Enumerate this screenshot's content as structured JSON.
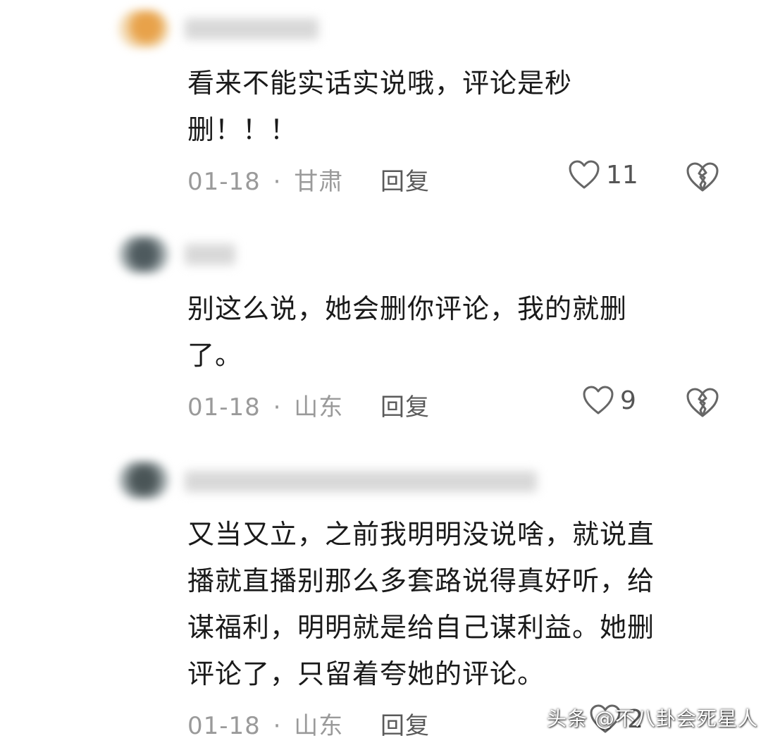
{
  "comments": [
    {
      "text_line1": "看来不能实话实说哦，评论是秒",
      "text_line2": "删！！！",
      "date": "01-18",
      "separator": "·",
      "location": "甘肃",
      "reply_label": "回复",
      "like_count": "11"
    },
    {
      "text_line1": "别这么说，她会删你评论，我的就删",
      "text_line2": "了。",
      "date": "01-18",
      "separator": "·",
      "location": "山东",
      "reply_label": "回复",
      "like_count": "9"
    },
    {
      "text_line1": "又当又立，之前我明明没说啥，就说直",
      "text_line2": "播就直播别那么多套路说得真好听，给",
      "text_line3": "谋福利，明明就是给自己谋利益。她删",
      "text_line4": "评论了，只留着夸她的评论。",
      "date": "01-18",
      "separator": "·",
      "location": "山东",
      "reply_label": "回复",
      "like_count": "2"
    }
  ],
  "watermark": "头条 @不八卦会死星人",
  "icons": {
    "like": "heart-outline-icon",
    "dislike": "broken-heart-icon"
  },
  "colors": {
    "text": "#1a1a1a",
    "meta": "#9a9a9a",
    "reply": "#5a5a5a",
    "icon": "#666666"
  }
}
